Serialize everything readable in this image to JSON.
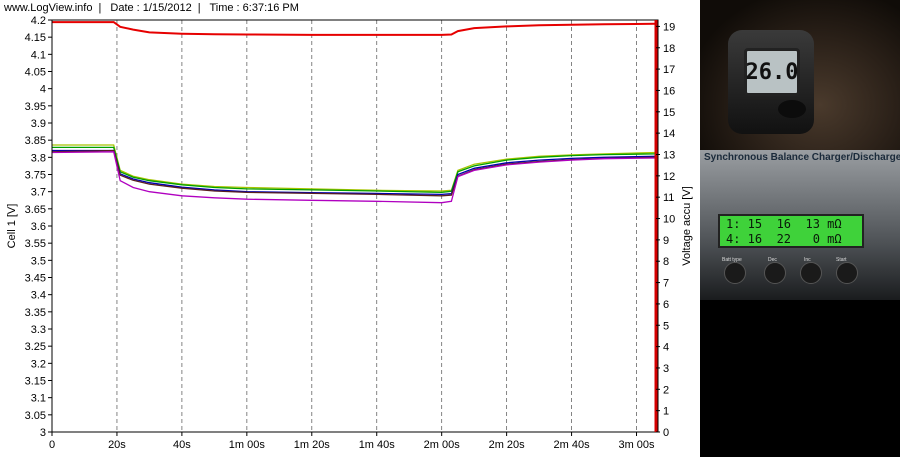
{
  "header": {
    "site": "www.LogView.info",
    "date": "Date : 1/15/2012",
    "time": "Time : 6:37:16 PM"
  },
  "chart_data": {
    "type": "line",
    "x_unit": "s",
    "x_ticks": [
      "0",
      "20s",
      "40s",
      "1m 00s",
      "1m 20s",
      "1m 40s",
      "2m 00s",
      "2m 20s",
      "2m 40s",
      "3m 00s"
    ],
    "x_tick_values": [
      0,
      20,
      40,
      60,
      80,
      100,
      120,
      140,
      160,
      180
    ],
    "xlim": [
      0,
      186
    ],
    "left_axis": {
      "label": "Cell 1 [V]",
      "ylim": [
        3.0,
        4.2
      ],
      "ticks": [
        "3",
        "3.05",
        "3.1",
        "3.15",
        "3.2",
        "3.25",
        "3.3",
        "3.35",
        "3.4",
        "3.45",
        "3.5",
        "3.55",
        "3.6",
        "3.65",
        "3.7",
        "3.75",
        "3.8",
        "3.85",
        "3.9",
        "3.95",
        "4",
        "4.05",
        "4.1",
        "4.15",
        "4.2"
      ]
    },
    "right_axis": {
      "label": "Voltage accu [V]",
      "ylim": [
        0,
        19.3
      ],
      "ticks": [
        "0",
        "1",
        "2",
        "3",
        "4",
        "5",
        "6",
        "7",
        "8",
        "9",
        "10",
        "11",
        "12",
        "13",
        "14",
        "15",
        "16",
        "17",
        "18",
        "19"
      ]
    },
    "grid": true,
    "series": [
      {
        "color": "#e60000",
        "axis": "right",
        "x": [
          0,
          19,
          21,
          25,
          30,
          40,
          50,
          60,
          80,
          100,
          120,
          123,
          125,
          130,
          140,
          150,
          160,
          170,
          186
        ],
        "y": [
          19.2,
          19.2,
          18.98,
          18.85,
          18.72,
          18.66,
          18.63,
          18.62,
          18.6,
          18.6,
          18.6,
          18.62,
          18.78,
          18.92,
          19.0,
          19.05,
          19.08,
          19.1,
          19.12
        ]
      },
      {
        "color": "#a6c400",
        "axis": "left",
        "x": [
          0,
          19,
          21,
          25,
          30,
          40,
          50,
          60,
          80,
          100,
          120,
          123,
          125,
          130,
          140,
          150,
          160,
          170,
          186
        ],
        "y": [
          3.836,
          3.836,
          3.762,
          3.745,
          3.735,
          3.722,
          3.715,
          3.712,
          3.708,
          3.704,
          3.702,
          3.704,
          3.762,
          3.78,
          3.795,
          3.803,
          3.807,
          3.81,
          3.814
        ]
      },
      {
        "color": "#00a000",
        "axis": "left",
        "x": [
          0,
          19,
          21,
          25,
          30,
          40,
          50,
          60,
          80,
          100,
          120,
          123,
          125,
          130,
          140,
          150,
          160,
          170,
          186
        ],
        "y": [
          3.829,
          3.829,
          3.758,
          3.742,
          3.732,
          3.72,
          3.712,
          3.708,
          3.705,
          3.702,
          3.698,
          3.701,
          3.758,
          3.775,
          3.792,
          3.8,
          3.805,
          3.808,
          3.81
        ]
      },
      {
        "color": "#0000b0",
        "axis": "left",
        "x": [
          0,
          19,
          21,
          25,
          30,
          40,
          50,
          60,
          80,
          100,
          120,
          123,
          125,
          130,
          140,
          150,
          160,
          170,
          186
        ],
        "y": [
          3.82,
          3.82,
          3.752,
          3.737,
          3.726,
          3.713,
          3.705,
          3.7,
          3.697,
          3.695,
          3.692,
          3.694,
          3.75,
          3.768,
          3.784,
          3.792,
          3.797,
          3.8,
          3.803
        ]
      },
      {
        "color": "#5a1e1e",
        "axis": "left",
        "x": [
          0,
          19,
          21,
          25,
          30,
          40,
          50,
          60,
          80,
          100,
          120,
          123,
          125,
          130,
          140,
          150,
          160,
          170,
          186
        ],
        "y": [
          3.816,
          3.82,
          3.748,
          3.733,
          3.722,
          3.71,
          3.702,
          3.698,
          3.695,
          3.692,
          3.688,
          3.69,
          3.745,
          3.764,
          3.78,
          3.788,
          3.793,
          3.797,
          3.8
        ]
      },
      {
        "color": "#b000c0",
        "axis": "left",
        "x": [
          0,
          19,
          21,
          25,
          30,
          40,
          50,
          60,
          80,
          100,
          120,
          123,
          125,
          130,
          140,
          150,
          160,
          170,
          186
        ],
        "y": [
          3.814,
          3.816,
          3.732,
          3.712,
          3.7,
          3.688,
          3.682,
          3.678,
          3.675,
          3.672,
          3.668,
          3.672,
          3.744,
          3.762,
          3.778,
          3.786,
          3.792,
          3.796,
          3.798
        ]
      }
    ]
  },
  "photo": {
    "thermometer_reading": "26.0",
    "charger_title": "Synchronous Balance Charger/Discharger",
    "lcd_lines": [
      "1: 15  16  13 mΩ",
      "4: 16  22   0 mΩ"
    ],
    "buttons": [
      "Batt type",
      "Dec",
      "Inc",
      "Start"
    ]
  }
}
